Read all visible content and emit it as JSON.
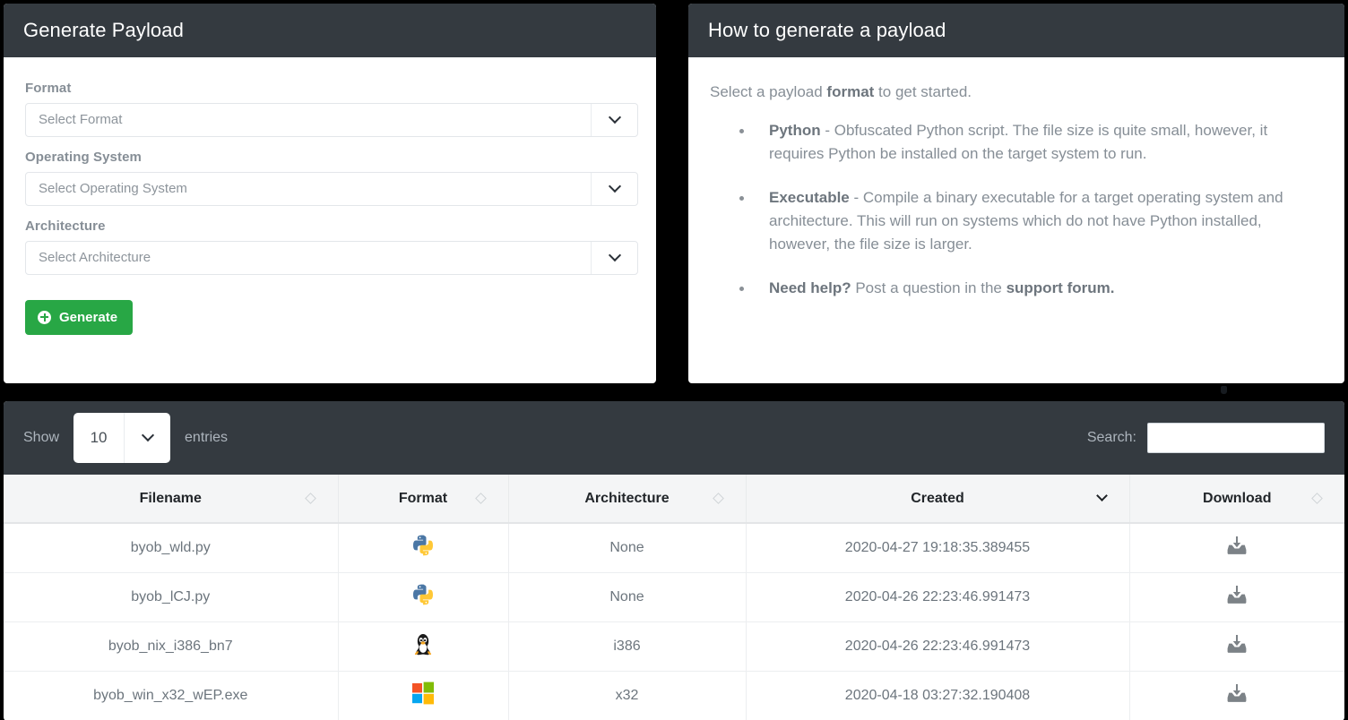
{
  "generate_card": {
    "title": "Generate Payload",
    "fields": [
      {
        "label": "Format",
        "placeholder": "Select Format",
        "value": ""
      },
      {
        "label": "Operating System",
        "placeholder": "Select Operating System",
        "value": ""
      },
      {
        "label": "Architecture",
        "placeholder": "Select Architecture",
        "value": ""
      }
    ],
    "generate_button": "Generate"
  },
  "help_card": {
    "title": "How to generate a payload",
    "intro_pre": "Select a payload ",
    "intro_bold": "format",
    "intro_post": " to get started.",
    "items": [
      {
        "bold": "Python",
        "text": " - Obfuscated Python script. The file size is quite small, however, it requires Python be installed on the target system to run."
      },
      {
        "bold": "Executable",
        "text": " - Compile a binary executable for a target operating system and architecture. This will run on systems which do not have Python installed, however, the file size is larger."
      },
      {
        "bold": "Need help?",
        "text": " Post a question in the ",
        "bold_tail": "support forum."
      }
    ]
  },
  "table": {
    "show_label": "Show",
    "entries_label": "entries",
    "page_length": "10",
    "search_label": "Search:",
    "search_value": "",
    "search_placeholder": "",
    "columns": [
      {
        "label": "Filename",
        "sort": "none"
      },
      {
        "label": "Format",
        "sort": "none"
      },
      {
        "label": "Architecture",
        "sort": "none"
      },
      {
        "label": "Created",
        "sort": "desc"
      },
      {
        "label": "Download",
        "sort": "none"
      }
    ],
    "rows": [
      {
        "filename": "byob_wld.py",
        "format_icon": "python-logo-icon",
        "architecture": "None",
        "created": "2020-04-27 19:18:35.389455",
        "download_icon": "download-tray-icon"
      },
      {
        "filename": "byob_lCJ.py",
        "format_icon": "python-logo-icon",
        "architecture": "None",
        "created": "2020-04-26 22:23:46.991473",
        "download_icon": "download-tray-icon"
      },
      {
        "filename": "byob_nix_i386_bn7",
        "format_icon": "linux-tux-icon",
        "architecture": "i386",
        "created": "2020-04-26 22:23:46.991473",
        "download_icon": "download-tray-icon"
      },
      {
        "filename": "byob_win_x32_wEP.exe",
        "format_icon": "windows-logo-icon",
        "architecture": "x32",
        "created": "2020-04-18 03:27:32.190408",
        "download_icon": "download-tray-icon"
      }
    ]
  },
  "colors": {
    "page_background": "#000000",
    "header_bar": "#343a40",
    "generate_button": "#28a745",
    "muted_text": "#868e96",
    "table_header_bg": "#f4f5f6"
  }
}
